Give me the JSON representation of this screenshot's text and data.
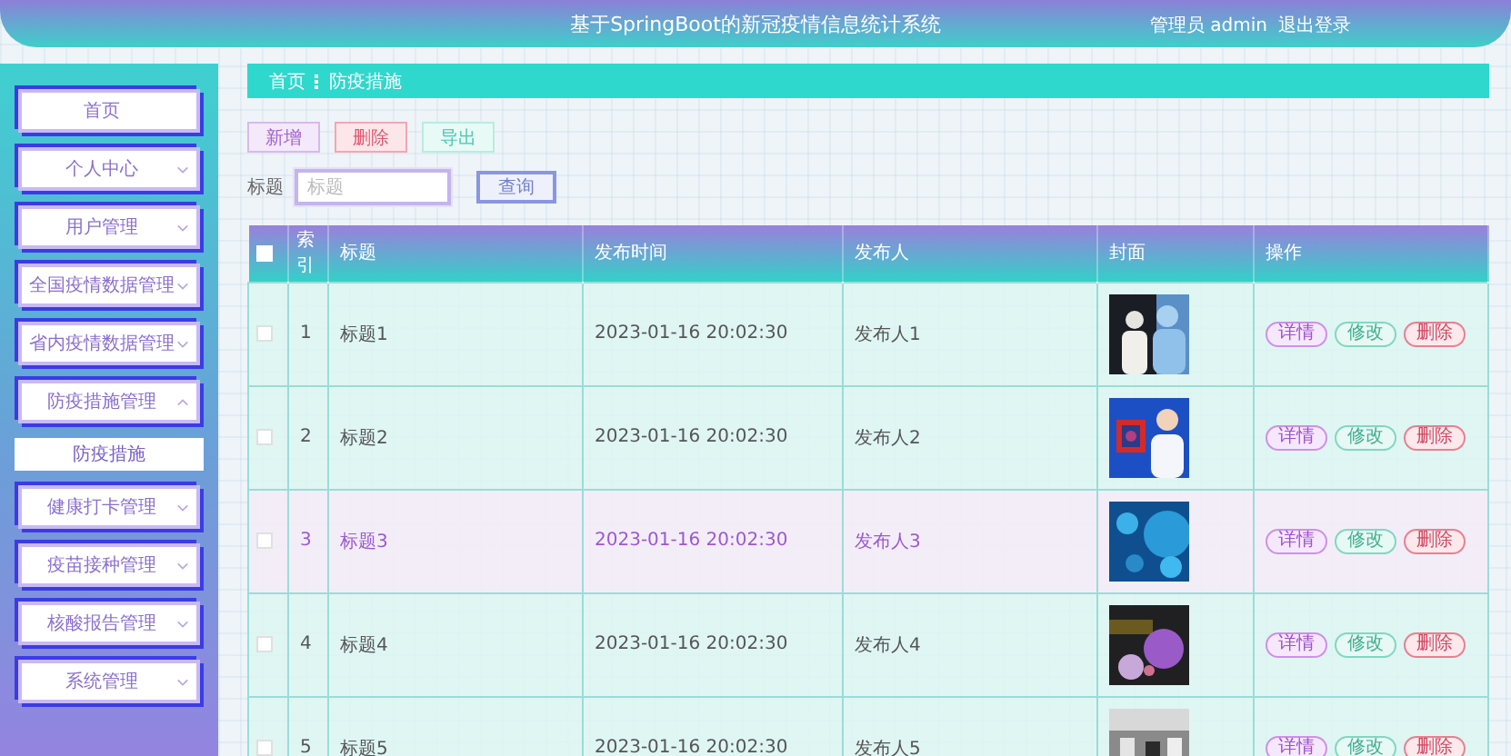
{
  "header": {
    "title": "基于SpringBoot的新冠疫情信息统计系统",
    "user": "管理员 admin",
    "logout": "退出登录"
  },
  "sidebar": {
    "items": [
      {
        "label": "首页",
        "kind": "link"
      },
      {
        "label": "个人中心",
        "kind": "menu"
      },
      {
        "label": "用户管理",
        "kind": "menu"
      },
      {
        "label": "全国疫情数据管理",
        "kind": "menu"
      },
      {
        "label": "省内疫情数据管理",
        "kind": "menu"
      },
      {
        "label": "防疫措施管理",
        "kind": "menu",
        "expanded": true,
        "children": [
          {
            "label": "防疫措施",
            "selected": true
          }
        ]
      },
      {
        "label": "健康打卡管理",
        "kind": "menu"
      },
      {
        "label": "疫苗接种管理",
        "kind": "menu"
      },
      {
        "label": "核酸报告管理",
        "kind": "menu"
      },
      {
        "label": "系统管理",
        "kind": "menu"
      }
    ]
  },
  "breadcrumb": [
    "首页",
    "防疫措施"
  ],
  "toolbar": {
    "buttons": [
      {
        "label": "新增",
        "kind": "add"
      },
      {
        "label": "删除",
        "kind": "delete"
      },
      {
        "label": "导出",
        "kind": "export"
      }
    ]
  },
  "search": {
    "label": "标题",
    "placeholder": "标题",
    "button": "查询"
  },
  "table": {
    "all_checked": false,
    "columns": [
      "索引",
      "标题",
      "发布时间",
      "发布人",
      "封面",
      "操作"
    ],
    "rows": [
      {
        "checked": false,
        "selected": false,
        "index": "1",
        "title": "标题1",
        "time": "2023-01-16 20:02:30",
        "publisher": "发布人1",
        "actions": [
          {
            "label": "详情",
            "kind": "detail"
          },
          {
            "label": "修改",
            "kind": "edit"
          },
          {
            "label": "删除",
            "kind": "delete"
          }
        ]
      },
      {
        "checked": false,
        "selected": false,
        "index": "2",
        "title": "标题2",
        "time": "2023-01-16 20:02:30",
        "publisher": "发布人2",
        "actions": [
          {
            "label": "详情",
            "kind": "detail"
          },
          {
            "label": "修改",
            "kind": "edit"
          },
          {
            "label": "删除",
            "kind": "delete"
          }
        ]
      },
      {
        "checked": false,
        "selected": true,
        "index": "3",
        "title": "标题3",
        "time": "2023-01-16 20:02:30",
        "publisher": "发布人3",
        "actions": [
          {
            "label": "详情",
            "kind": "detail"
          },
          {
            "label": "修改",
            "kind": "edit"
          },
          {
            "label": "删除",
            "kind": "delete"
          }
        ]
      },
      {
        "checked": false,
        "selected": false,
        "index": "4",
        "title": "标题4",
        "time": "2023-01-16 20:02:30",
        "publisher": "发布人4",
        "actions": [
          {
            "label": "详情",
            "kind": "detail"
          },
          {
            "label": "修改",
            "kind": "edit"
          },
          {
            "label": "删除",
            "kind": "delete"
          }
        ]
      },
      {
        "checked": false,
        "selected": false,
        "index": "5",
        "title": "标题5",
        "time": "2023-01-16 20:02:30",
        "publisher": "发布人5",
        "actions": [
          {
            "label": "详情",
            "kind": "detail"
          },
          {
            "label": "修改",
            "kind": "edit"
          },
          {
            "label": "删除",
            "kind": "delete"
          }
        ]
      }
    ]
  }
}
